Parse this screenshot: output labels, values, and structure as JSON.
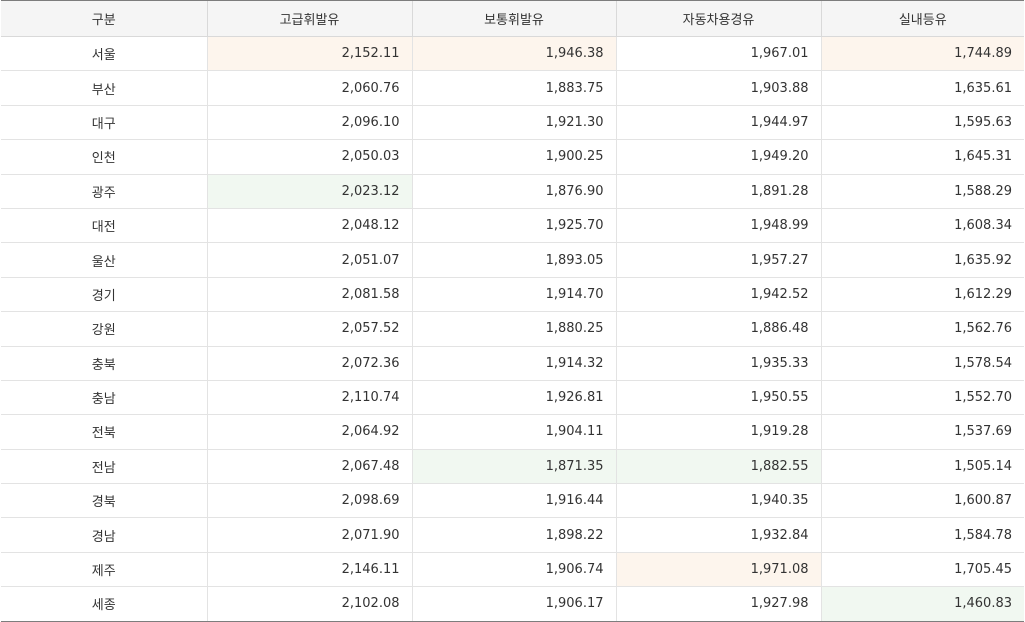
{
  "colors": {
    "highest": "#fdf5ed",
    "lowest": "#f1f8f1",
    "header_bg": "#f5f5f5"
  },
  "table": {
    "headers": [
      "구분",
      "고급휘발유",
      "보통휘발유",
      "자동차용경유",
      "실내등유"
    ],
    "rows": [
      {
        "region": "서울",
        "values": [
          "2,152.11",
          "1,946.38",
          "1,967.01",
          "1,744.89"
        ],
        "hl": [
          "hi",
          "hi",
          "",
          "hi"
        ]
      },
      {
        "region": "부산",
        "values": [
          "2,060.76",
          "1,883.75",
          "1,903.88",
          "1,635.61"
        ],
        "hl": [
          "",
          "",
          "",
          ""
        ]
      },
      {
        "region": "대구",
        "values": [
          "2,096.10",
          "1,921.30",
          "1,944.97",
          "1,595.63"
        ],
        "hl": [
          "",
          "",
          "",
          ""
        ]
      },
      {
        "region": "인천",
        "values": [
          "2,050.03",
          "1,900.25",
          "1,949.20",
          "1,645.31"
        ],
        "hl": [
          "",
          "",
          "",
          ""
        ]
      },
      {
        "region": "광주",
        "values": [
          "2,023.12",
          "1,876.90",
          "1,891.28",
          "1,588.29"
        ],
        "hl": [
          "lo",
          "",
          "",
          ""
        ]
      },
      {
        "region": "대전",
        "values": [
          "2,048.12",
          "1,925.70",
          "1,948.99",
          "1,608.34"
        ],
        "hl": [
          "",
          "",
          "",
          ""
        ]
      },
      {
        "region": "울산",
        "values": [
          "2,051.07",
          "1,893.05",
          "1,957.27",
          "1,635.92"
        ],
        "hl": [
          "",
          "",
          "",
          ""
        ]
      },
      {
        "region": "경기",
        "values": [
          "2,081.58",
          "1,914.70",
          "1,942.52",
          "1,612.29"
        ],
        "hl": [
          "",
          "",
          "",
          ""
        ]
      },
      {
        "region": "강원",
        "values": [
          "2,057.52",
          "1,880.25",
          "1,886.48",
          "1,562.76"
        ],
        "hl": [
          "",
          "",
          "",
          ""
        ]
      },
      {
        "region": "충북",
        "values": [
          "2,072.36",
          "1,914.32",
          "1,935.33",
          "1,578.54"
        ],
        "hl": [
          "",
          "",
          "",
          ""
        ]
      },
      {
        "region": "충남",
        "values": [
          "2,110.74",
          "1,926.81",
          "1,950.55",
          "1,552.70"
        ],
        "hl": [
          "",
          "",
          "",
          ""
        ]
      },
      {
        "region": "전북",
        "values": [
          "2,064.92",
          "1,904.11",
          "1,919.28",
          "1,537.69"
        ],
        "hl": [
          "",
          "",
          "",
          ""
        ]
      },
      {
        "region": "전남",
        "values": [
          "2,067.48",
          "1,871.35",
          "1,882.55",
          "1,505.14"
        ],
        "hl": [
          "",
          "lo",
          "lo",
          ""
        ]
      },
      {
        "region": "경북",
        "values": [
          "2,098.69",
          "1,916.44",
          "1,940.35",
          "1,600.87"
        ],
        "hl": [
          "",
          "",
          "",
          ""
        ]
      },
      {
        "region": "경남",
        "values": [
          "2,071.90",
          "1,898.22",
          "1,932.84",
          "1,584.78"
        ],
        "hl": [
          "",
          "",
          "",
          ""
        ]
      },
      {
        "region": "제주",
        "values": [
          "2,146.11",
          "1,906.74",
          "1,971.08",
          "1,705.45"
        ],
        "hl": [
          "",
          "",
          "hi",
          ""
        ]
      },
      {
        "region": "세종",
        "values": [
          "2,102.08",
          "1,906.17",
          "1,927.98",
          "1,460.83"
        ],
        "hl": [
          "",
          "",
          "",
          "lo"
        ]
      }
    ]
  }
}
